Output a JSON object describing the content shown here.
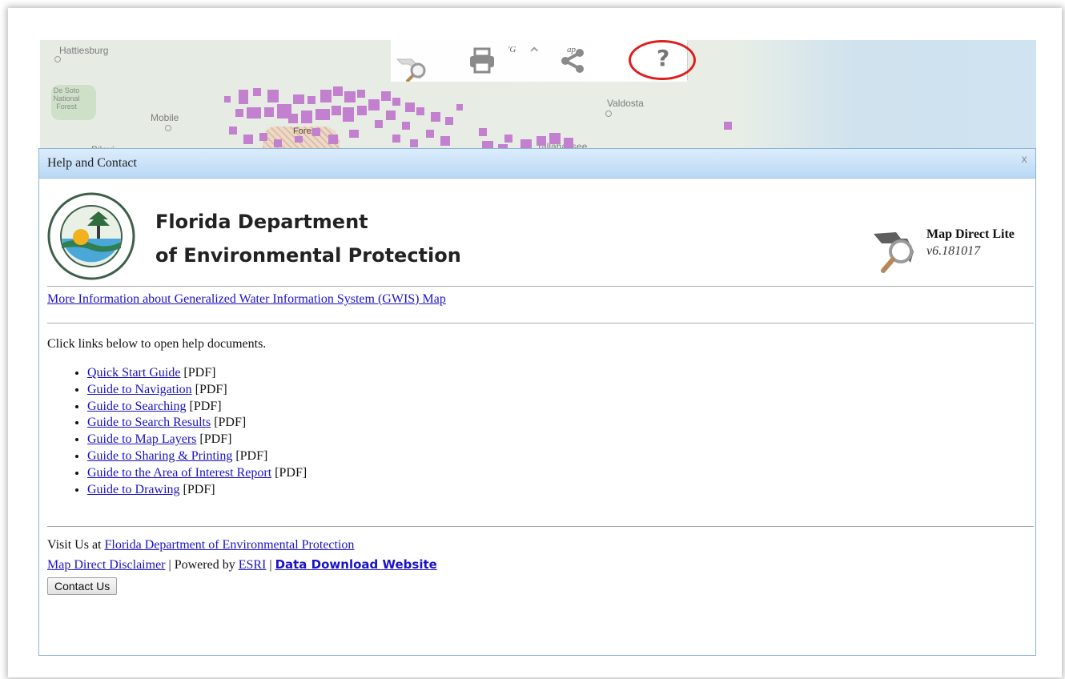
{
  "map": {
    "labels": {
      "hattiesburg": "Hattiesburg",
      "desoto": "De Soto National Forest",
      "mobile": "Mobile",
      "biloxi": "Biloxi",
      "valdosta": "Valdosta",
      "tallahassee": "Tallahassee",
      "forest": "Forest"
    },
    "block_color": "#c280cf"
  },
  "toolbar": {
    "frag1": "'G",
    "frag2": "ap",
    "up_glyph": "⌃",
    "help_glyph": "?",
    "icons": [
      "map-direct-logo-icon",
      "print-icon",
      "chevron-up-icon",
      "share-icon",
      "help-icon"
    ],
    "highlight_color": "#e21d1d"
  },
  "dialog": {
    "title": "Help and Contact",
    "close": "x",
    "agency_line1": "Florida Department",
    "agency_line2": "of Environmental Protection",
    "app_name": "Map Direct Lite",
    "version": "v6.181017",
    "more_info": "More Information about Generalized Water Information System (GWIS) Map",
    "intro": "Click links below to open help documents.",
    "guides": [
      {
        "label": "Quick Start Guide",
        "suffix": " [PDF]"
      },
      {
        "label": "Guide to Navigation",
        "suffix": " [PDF]"
      },
      {
        "label": "Guide to Searching",
        "suffix": " [PDF]"
      },
      {
        "label": "Guide to Search Results",
        "suffix": " [PDF]"
      },
      {
        "label": "Guide to Map Layers",
        "suffix": " [PDF]"
      },
      {
        "label": "Guide to Sharing & Printing",
        "suffix": " [PDF]"
      },
      {
        "label": "Guide to the Area of Interest Report",
        "suffix": " [PDF]"
      },
      {
        "label": "Guide to Drawing",
        "suffix": " [PDF]"
      }
    ],
    "footer": {
      "visit_prefix": "Visit Us at ",
      "visit_link": "Florida Department of Environmental Protection",
      "disclaimer": "Map Direct Disclaimer",
      "sep1": " | Powered by ",
      "esri": "ESRI",
      "sep2": " | ",
      "data_download": "Data Download Website",
      "contact_button": "Contact Us"
    },
    "header_gradient": [
      "#dcedfc",
      "#b9d8f5"
    ]
  }
}
